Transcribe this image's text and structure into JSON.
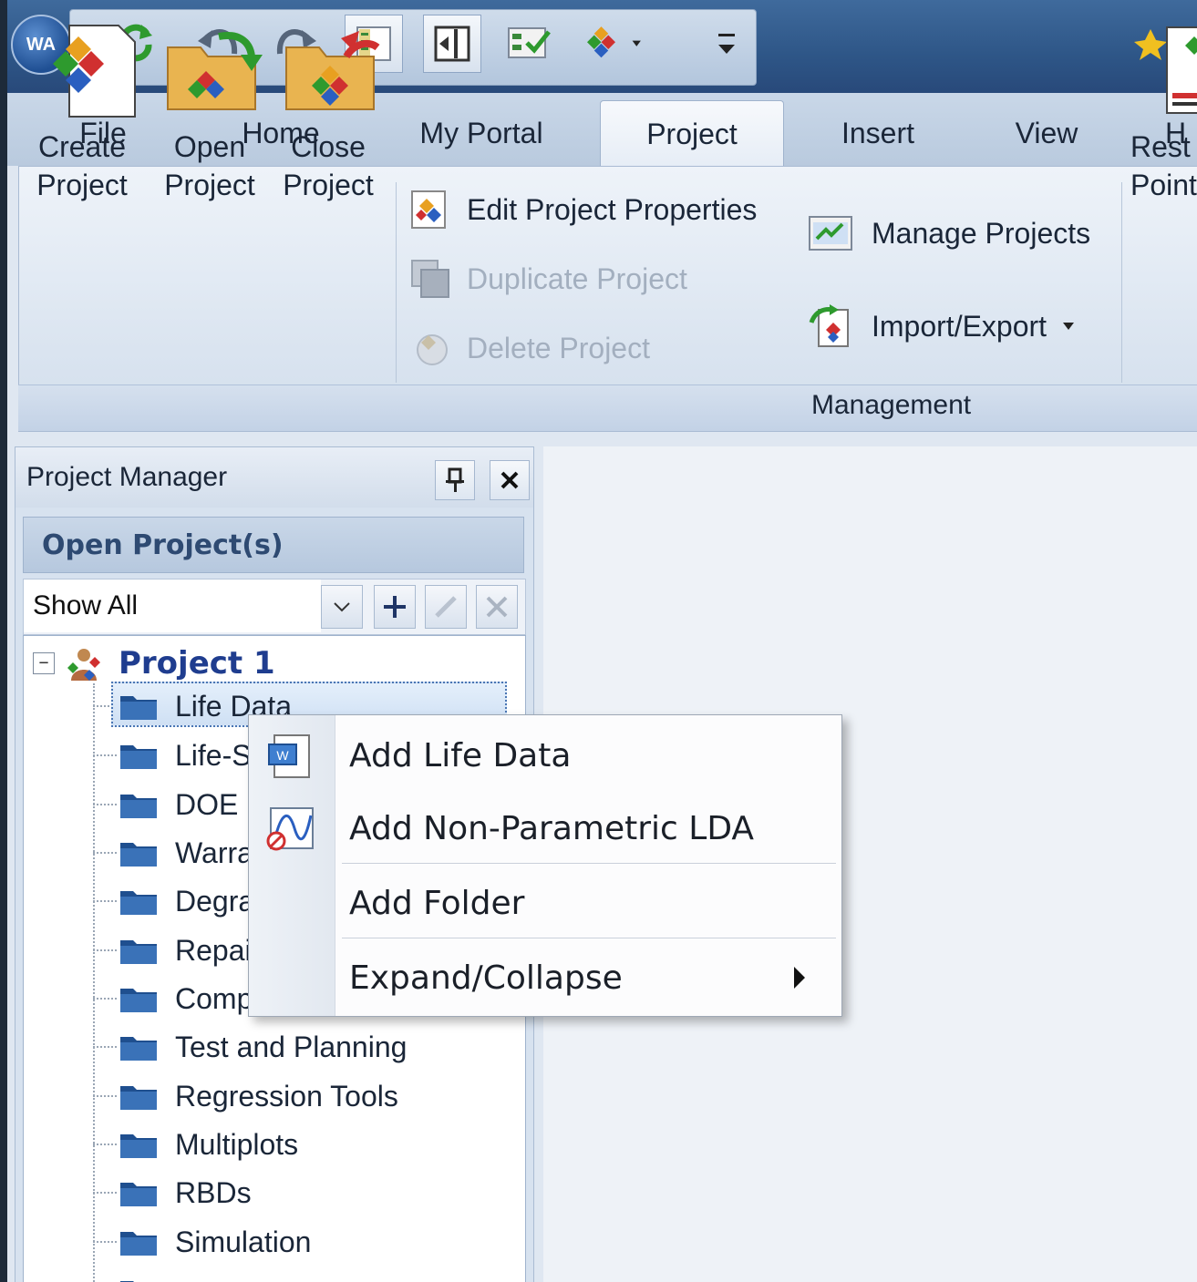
{
  "app": {
    "logo_text": "WA"
  },
  "quick_access": {
    "icons": [
      "refresh-icon",
      "undo-icon",
      "redo-icon",
      "layout-left-icon",
      "layout-exit-icon",
      "checklist-icon",
      "project-dropdown-icon",
      "customize-toolbar-icon"
    ]
  },
  "tabs": [
    {
      "label": "File",
      "active": false
    },
    {
      "label": "Home",
      "active": false
    },
    {
      "label": "My Portal",
      "active": false
    },
    {
      "label": "Project",
      "active": true
    },
    {
      "label": "Insert",
      "active": false
    },
    {
      "label": "View",
      "active": false
    },
    {
      "label": "H",
      "active": false
    }
  ],
  "ribbon": {
    "create_project": {
      "line1": "Create",
      "line2": "Project"
    },
    "open_project": {
      "line1": "Open",
      "line2": "Project"
    },
    "close_project": {
      "line1": "Close",
      "line2": "Project"
    },
    "edit_properties": "Edit Project Properties",
    "duplicate_project": "Duplicate Project",
    "delete_project": "Delete Project",
    "manage_projects": "Manage Projects",
    "import_export": "Import/Export",
    "restore_point": {
      "line1": "Rest",
      "line2": "Point"
    },
    "group_management": "Management"
  },
  "project_manager": {
    "title": "Project Manager",
    "open_projects_header": "Open Project(s)",
    "filter_value": "Show All",
    "root_label": "Project 1",
    "items": [
      "Life Data",
      "Life-S",
      "DOE",
      "Warra",
      "Degra",
      "Repai",
      "Comp",
      "Test and Planning",
      "Regression Tools",
      "Multiplots",
      "RBDs",
      "Simulation"
    ]
  },
  "context_menu": {
    "items": [
      {
        "label": "Add Life Data"
      },
      {
        "label": "Add Non-Parametric LDA"
      },
      {
        "label": "Add Folder"
      },
      {
        "label": "Expand/Collapse"
      }
    ]
  },
  "colors": {
    "title_bar": "#2e5687",
    "ribbon": "#dae4f0",
    "root_label": "#1f3d8f",
    "open_header_text": "#2e4a72"
  }
}
